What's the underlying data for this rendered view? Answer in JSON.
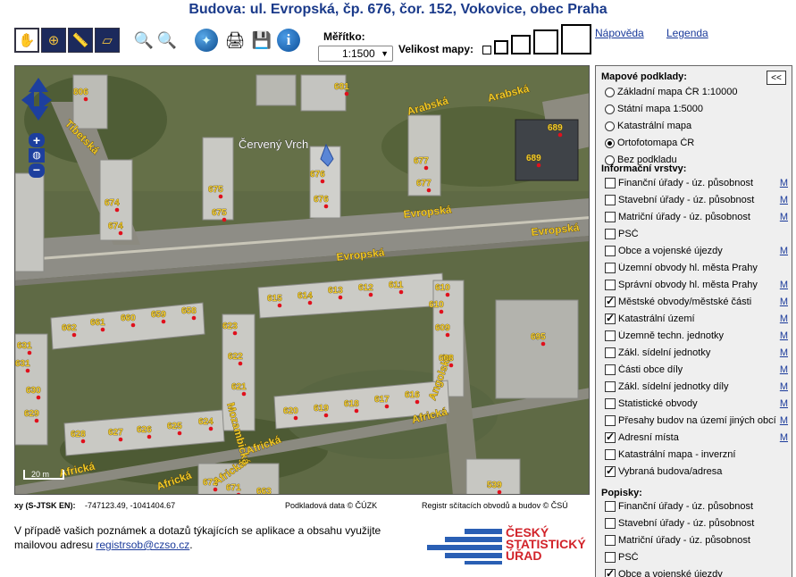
{
  "title": "Budova: ul. Evropská, čp. 676, čor. 152, Vokovice, obec Praha",
  "scale": {
    "label": "Měřítko:",
    "value": "1:1500"
  },
  "map_size": {
    "label": "Velikost mapy:"
  },
  "links": {
    "help": "Nápověda",
    "legend": "Legenda"
  },
  "map": {
    "scalebar": "20 m",
    "place_label": "Červený Vrch",
    "streets": [
      "Evropská",
      "Evropská",
      "Evropská",
      "Arabská",
      "Arabská",
      "Tibetská",
      "Angolská",
      "Africká",
      "Africká",
      "Africká",
      "Africká",
      "Africká",
      "Mozambická"
    ],
    "addresses": [
      "806",
      "681",
      "689",
      "689",
      "676",
      "677",
      "677",
      "675",
      "675",
      "676",
      "674",
      "674",
      "615",
      "614",
      "613",
      "612",
      "611",
      "610",
      "610",
      "662",
      "661",
      "660",
      "659",
      "658",
      "623",
      "609",
      "631",
      "622",
      "608",
      "695",
      "631",
      "630",
      "621",
      "629",
      "620",
      "619",
      "618",
      "617",
      "616",
      "628",
      "627",
      "626",
      "625",
      "624",
      "672",
      "671",
      "663",
      "539"
    ]
  },
  "footer": {
    "xy_label": "xy (S-JTSK EN):",
    "xy_value": "-747123.49, -1041404.67",
    "source": "Podkladová data © ČÚZK",
    "register": "Registr sčítacích obvodů a budov © ČSÚ"
  },
  "note": {
    "text": "V případě vašich poznámek a dotazů týkajících se aplikace a obsahu využijte mailovou adresu ",
    "email": "registrsob@czso.cz",
    "suffix": "."
  },
  "logo": {
    "line1": "ČESKÝ",
    "line2": "STATISTICKÝ",
    "line3": "ÚŘAD"
  },
  "panel": {
    "collapse": "<<",
    "basemaps_title": "Mapové podklady:",
    "layers_title": "Informační vrstvy:",
    "labels_title": "Popisky:",
    "basemaps": [
      {
        "label": "Základní mapa ČR 1:10000",
        "checked": false
      },
      {
        "label": "Státní mapa 1:5000",
        "checked": false
      },
      {
        "label": "Katastrální mapa",
        "checked": false
      },
      {
        "label": "Ortofotomapa ČR",
        "checked": true
      },
      {
        "label": "Bez podkladu",
        "checked": false
      }
    ],
    "layers": [
      {
        "label": "Finanční úřady - úz. působnost",
        "checked": false,
        "meta": "M"
      },
      {
        "label": "Stavební úřady - úz. působnost",
        "checked": false,
        "meta": "M"
      },
      {
        "label": "Matriční úřady - úz. působnost",
        "checked": false,
        "meta": "M"
      },
      {
        "label": "PSČ",
        "checked": false,
        "meta": ""
      },
      {
        "label": "Obce a vojenské újezdy",
        "checked": false,
        "meta": "M"
      },
      {
        "label": "Územní obvody hl. města Prahy",
        "checked": false,
        "meta": ""
      },
      {
        "label": "Správní obvody hl. města Prahy",
        "checked": false,
        "meta": "M"
      },
      {
        "label": "Městské obvody/městské části",
        "checked": true,
        "meta": "M"
      },
      {
        "label": "Katastrální území",
        "checked": true,
        "meta": "M"
      },
      {
        "label": "Územně techn. jednotky",
        "checked": false,
        "meta": "M"
      },
      {
        "label": "Zákl. sídelní jednotky",
        "checked": false,
        "meta": "M"
      },
      {
        "label": "Části obce díly",
        "checked": false,
        "meta": "M"
      },
      {
        "label": "Zákl. sídelní jednotky díly",
        "checked": false,
        "meta": "M"
      },
      {
        "label": "Statistické obvody",
        "checked": false,
        "meta": "M"
      },
      {
        "label": "Přesahy budov na území jiných obcí",
        "checked": false,
        "meta": "M"
      },
      {
        "label": "Adresní místa",
        "checked": true,
        "meta": "M"
      },
      {
        "label": "Katastrální mapa - inverzní",
        "checked": false,
        "meta": ""
      },
      {
        "label": "Vybraná budova/adresa",
        "checked": true,
        "meta": ""
      }
    ],
    "labels": [
      {
        "label": "Finanční úřady - úz. působnost",
        "checked": false
      },
      {
        "label": "Stavební úřady - úz. působnost",
        "checked": false
      },
      {
        "label": "Matriční úřady - úz. působnost",
        "checked": false
      },
      {
        "label": "PSČ",
        "checked": false
      },
      {
        "label": "Obce a vojenské újezdy",
        "checked": true
      }
    ]
  }
}
